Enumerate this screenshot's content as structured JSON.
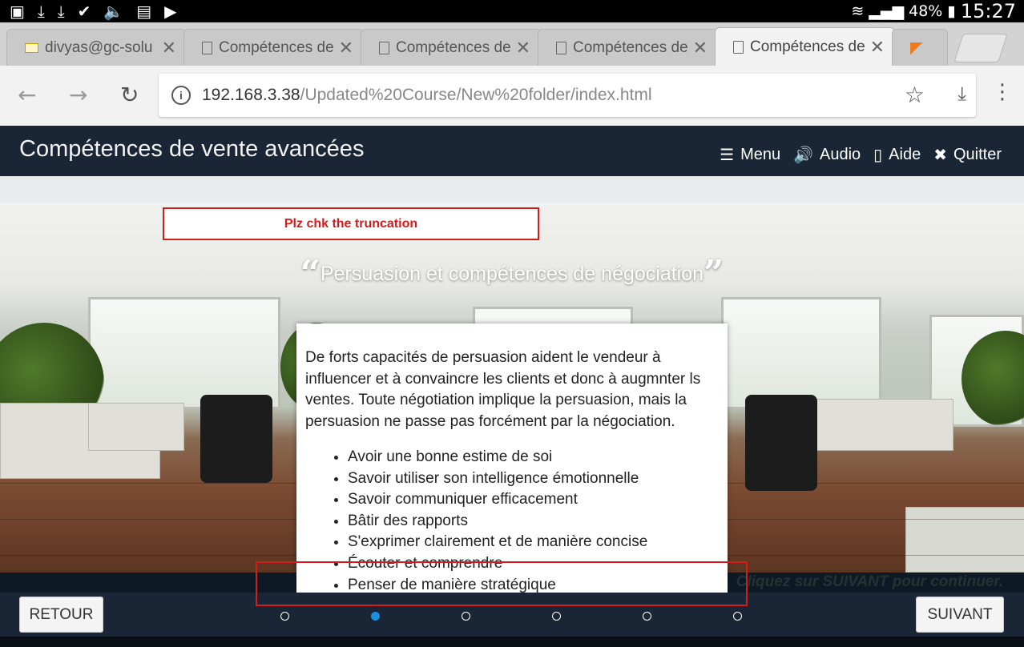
{
  "status_bar": {
    "battery": "48%",
    "time": "15:27"
  },
  "tabs": [
    {
      "title": "divyas@gc-solu",
      "icon": "mail-icon"
    },
    {
      "title": "Compétences de",
      "icon": "doc-icon"
    },
    {
      "title": "Compétences de",
      "icon": "doc-icon"
    },
    {
      "title": "Compétences de",
      "icon": "doc-icon"
    },
    {
      "title": "Compétences de",
      "icon": "doc-icon",
      "active": true
    }
  ],
  "address": {
    "host": "192.168.3.38",
    "path": "/Updated%20Course/New%20folder/index.html"
  },
  "course": {
    "title": "Compétences de vente avancées",
    "nav": {
      "menu": "Menu",
      "audio": "Audio",
      "help": "Aide",
      "quit": "Quitter"
    }
  },
  "review_note": "Plz chk the truncation",
  "slide": {
    "heading": "Persuasion et compétences de négociation",
    "intro": "De forts capacités de persuasion aident le vendeur à influencer et à convaincre les clients et donc à augmnter ls ventes. Toute négotiation implique la persuasion, mais la persuasion ne passe pas forcément par la négociation.",
    "bullets": [
      "Avoir une bonne estime de soi",
      "Savoir utiliser son intelligence émotionnelle",
      "Savoir communiquer efficacement",
      "Bâtir des rapports",
      "S'exprimer clairement et de manière concise",
      "Écouter et comprendre",
      "Penser de manière stratégique"
    ]
  },
  "continue_prompt": "Cliquez sur SUIVANT pour continuer.",
  "footer": {
    "back": "RETOUR",
    "next": "SUIVANT",
    "pages": 6,
    "current_page": 2
  },
  "colors": {
    "header_bg": "#1a2636",
    "accent": "#1e8fe1",
    "flag": "#d31d1d"
  }
}
